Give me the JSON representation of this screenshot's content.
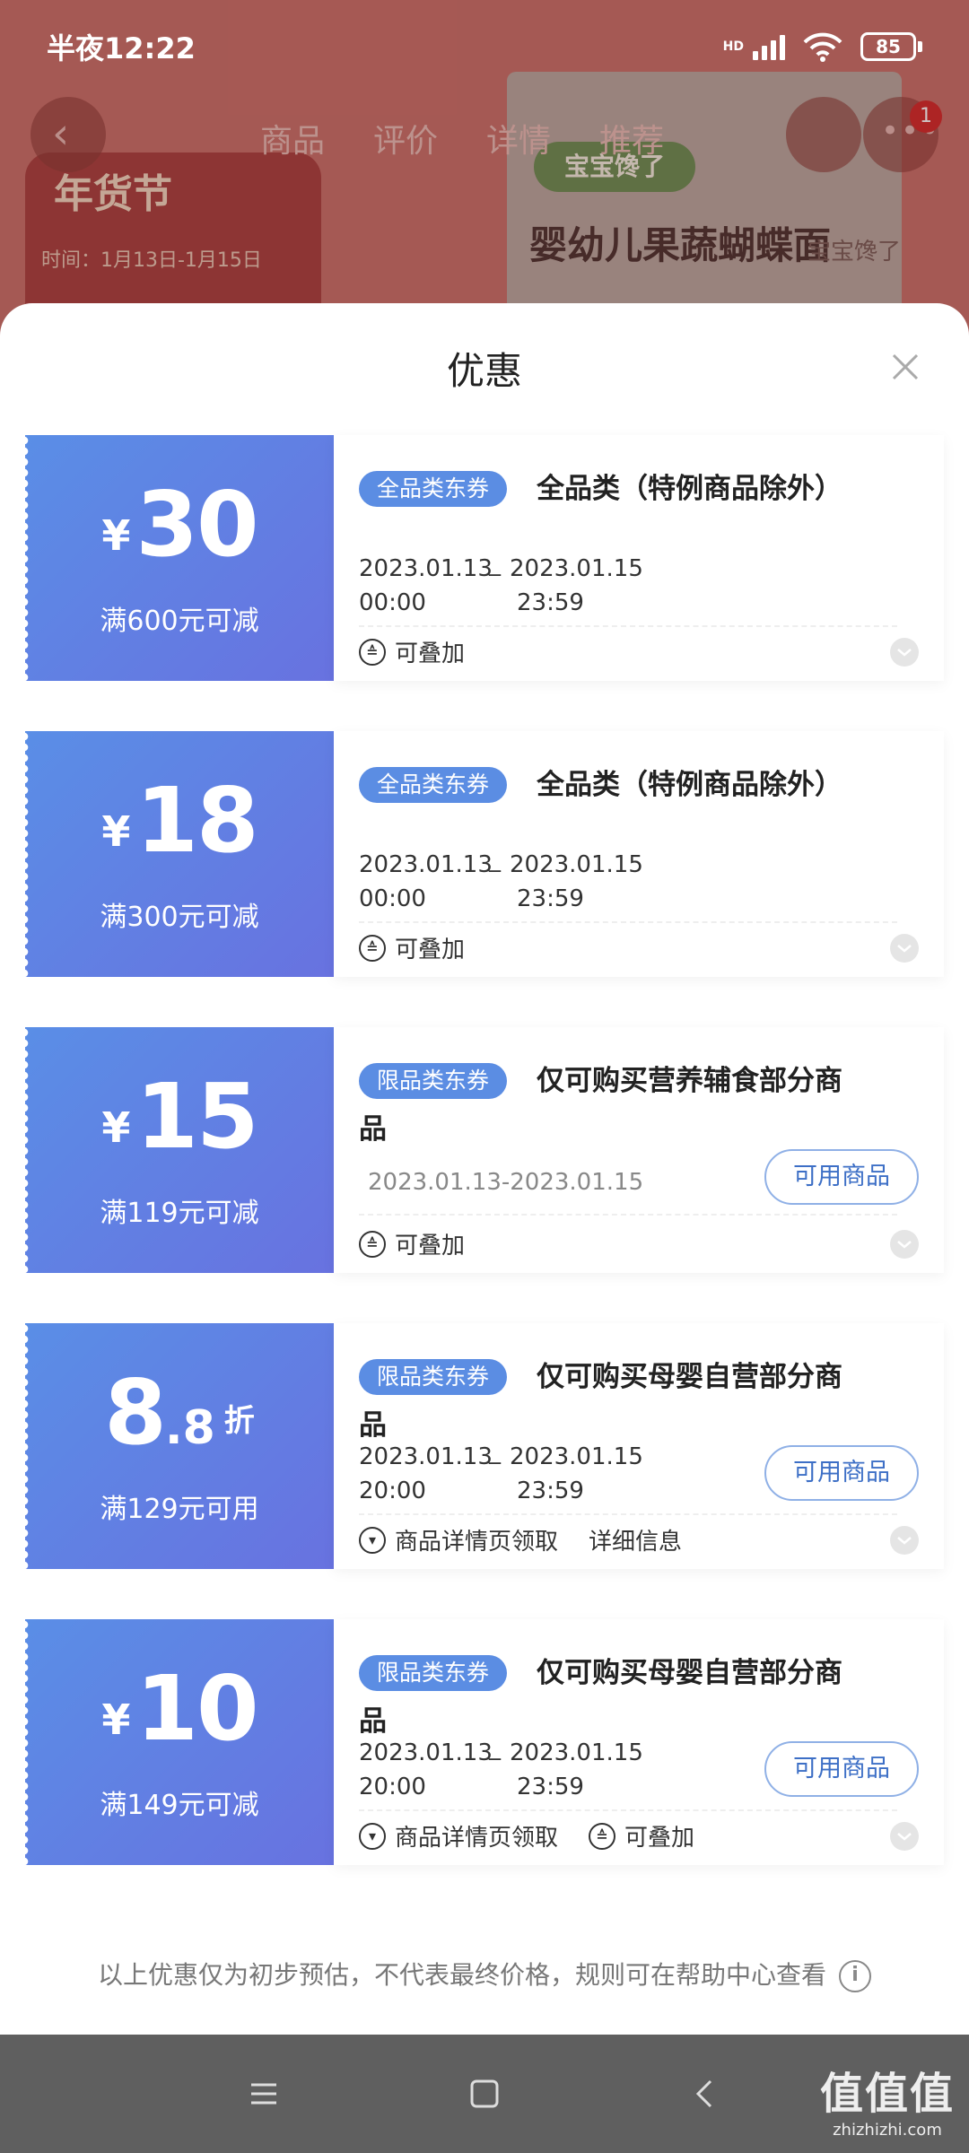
{
  "status_bar": {
    "time": "半夜12:22",
    "network_label": "HD",
    "battery_level": "85"
  },
  "background": {
    "nav_tabs": [
      "商品",
      "评价",
      "详情",
      "推荐"
    ],
    "banner_title": "年货节",
    "banner_sub": "时间：1月13日-1月15日",
    "product_logo": "宝宝馋了",
    "product_name": "婴幼儿果蔬蝴蝶面",
    "product_brand": "宝宝馋了",
    "notification_count": "1"
  },
  "sheet": {
    "title": "优惠"
  },
  "coupons": [
    {
      "currency": "¥",
      "amount": "30",
      "condition": "满600元可减",
      "tag": "全品类东券",
      "title": "全品类（特例商品除外）",
      "start_date": "2023.01.13",
      "start_time": "00:00",
      "end_date": "2023.01.15",
      "end_time": "23:59",
      "stack_label": "可叠加"
    },
    {
      "currency": "¥",
      "amount": "18",
      "condition": "满300元可减",
      "tag": "全品类东券",
      "title": "全品类（特例商品除外）",
      "start_date": "2023.01.13",
      "start_time": "00:00",
      "end_date": "2023.01.15",
      "end_time": "23:59",
      "stack_label": "可叠加"
    },
    {
      "currency": "¥",
      "amount": "15",
      "condition": "满119元可减",
      "tag": "限品类东券",
      "title_line1": "仅可购买营养辅食部分商",
      "title_line2": "品",
      "date_range": "2023.01.13-2023.01.15",
      "button": "可用商品",
      "stack_label": "可叠加"
    },
    {
      "amount_int": "8",
      "amount_dec": ".8",
      "amount_unit": "折",
      "condition": "满129元可用",
      "tag": "限品类东券",
      "title_line1": "仅可购买母婴自营部分商",
      "title_line2": "品",
      "start_date": "2023.01.13",
      "start_time": "20:00",
      "end_date": "2023.01.15",
      "end_time": "23:59",
      "button": "可用商品",
      "claim_label": "商品详情页领取",
      "detail_label": "详细信息"
    },
    {
      "currency": "¥",
      "amount": "10",
      "condition": "满149元可减",
      "tag": "限品类东券",
      "title_line1": "仅可购买母婴自营部分商",
      "title_line2": "品",
      "start_date": "2023.01.13",
      "start_time": "20:00",
      "end_date": "2023.01.15",
      "end_time": "23:59",
      "button": "可用商品",
      "claim_label": "商品详情页领取",
      "stack_label": "可叠加"
    }
  ],
  "footer": {
    "note": "以上优惠仅为初步预估，不代表最终价格，规则可在帮助中心查看"
  },
  "watermark": {
    "big": "值值值",
    "small": "zhizhizhi.com"
  },
  "colors": {
    "coupon_gradient_start": "#5a8ee6",
    "coupon_gradient_end": "#6872e0",
    "tag_bg": "#5b8de3",
    "button_text": "#3d6fc6"
  }
}
